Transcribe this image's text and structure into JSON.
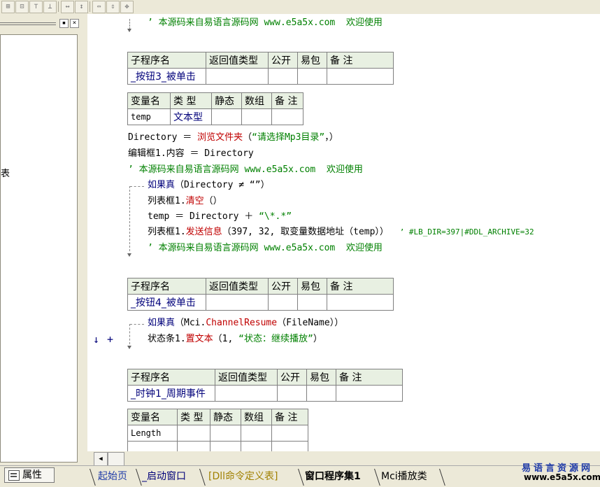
{
  "tabs": [
    {
      "label": "起始页",
      "color": "#1e3aa8"
    },
    {
      "label": "_启动窗口",
      "color": "#00007a"
    },
    {
      "label": "[Dll命令定义表]",
      "color": "#a08000"
    },
    {
      "label": "窗口程序集1",
      "color": "#000000"
    },
    {
      "label": "Mci播放类",
      "color": "#000000"
    }
  ],
  "properties_tab": "属性",
  "left_panel_char": "表",
  "logo": {
    "title": "易语言资源网",
    "url": "www.e5a5x.com"
  },
  "sub_header": [
    "子程序名",
    "返回值类型",
    "公开",
    "易包",
    "备 注"
  ],
  "var_header": [
    "变量名",
    "类 型",
    "静态",
    "数组",
    "备 注"
  ],
  "comment_text": "’ 本源码来自易语言源码网 www.e5a5x.com  欢迎使用",
  "sub1": {
    "name": "_按钮3_被单击",
    "vars": [
      {
        "name": "temp",
        "type": "文本型"
      }
    ]
  },
  "sub2": {
    "name": "_按钮4_被单击"
  },
  "sub3": {
    "name": "_时钟1_周期事件",
    "vars": [
      {
        "name": "Length",
        "type": ""
      }
    ]
  },
  "code": {
    "l1_a": "Directory ＝ ",
    "l1_fn": "浏览文件夹",
    "l1_b": "（",
    "l1_str": "“请选择Mp3目录”",
    "l1_c": "，）",
    "l2": "编辑框1.内容 ＝ Directory",
    "if1_kw": "如果真",
    "if1_rest": "（Directory ≠ “”）",
    "l4_a": "列表框1.",
    "l4_fn": "清空",
    "l4_b": "（）",
    "l5_a": "temp ＝ Directory ＋ ",
    "l5_str": "“\\*.*”",
    "l6_a": "列表框1.",
    "l6_fn": "发送信息",
    "l6_b": "（397, 32, 取变量数据地址（temp））",
    "l6_cm": "’ #LB_DIR=397|#DDL_ARCHIVE=32",
    "if2_kw": "如果真",
    "if2_a": "（Mci.",
    "if2_fn": "ChannelResume",
    "if2_b": "（FileName））",
    "l8_a": "状态条1.",
    "l8_fn": "置文本",
    "l8_b": "（1, ",
    "l8_str": "“状态：继续播放”",
    "l8_c": "）"
  },
  "gutter_marks": {
    "arrow": "↓",
    "plus": "+"
  }
}
